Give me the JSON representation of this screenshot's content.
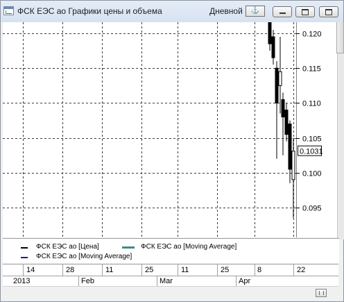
{
  "window": {
    "title": "ФСК ЕЭС ао Графики цены и объема",
    "period": "Дневной",
    "anchor_glyph": "⚓"
  },
  "chart_data": {
    "type": "candlestick",
    "y_ticks": [
      "0.120",
      "0.115",
      "0.110",
      "0.105",
      "0.100",
      "0.095"
    ],
    "current_price": "0.1031",
    "ylim": [
      0.091,
      0.124
    ],
    "grid": true,
    "candles": [
      {
        "open": 0.124,
        "high": 0.125,
        "low": 0.1175,
        "close": 0.1185
      },
      {
        "open": 0.1195,
        "high": 0.1205,
        "low": 0.1155,
        "close": 0.1165
      },
      {
        "open": 0.115,
        "high": 0.116,
        "low": 0.102,
        "close": 0.11
      },
      {
        "open": 0.1125,
        "high": 0.1195,
        "low": 0.1085,
        "close": 0.1145
      },
      {
        "open": 0.1105,
        "high": 0.1115,
        "low": 0.1025,
        "close": 0.108
      },
      {
        "open": 0.109,
        "high": 0.11,
        "low": 0.1045,
        "close": 0.1055
      },
      {
        "open": 0.107,
        "high": 0.1075,
        "low": 0.0985,
        "close": 0.1005
      },
      {
        "open": 0.099,
        "high": 0.105,
        "low": 0.0935,
        "close": 0.1031
      }
    ],
    "legend": [
      {
        "label": "ФСК ЕЭС ао [Цена]",
        "color": "#000000"
      },
      {
        "label": "ФСК ЕЭС ао [Moving Average]",
        "color": "#3d8c84"
      },
      {
        "label": "ФСК ЕЭС ао [Moving Average]",
        "color": "#1a1a8c"
      }
    ],
    "day_ticks": [
      "14",
      "28",
      "11",
      "25",
      "11",
      "25",
      "8",
      "22"
    ],
    "month_labels": [
      "2013",
      "Feb",
      "Mar",
      "Apr"
    ]
  }
}
